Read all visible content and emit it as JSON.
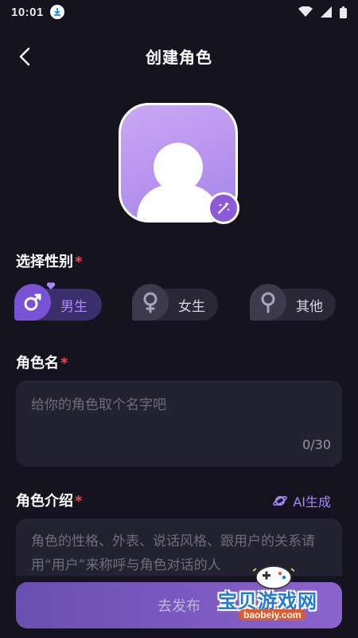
{
  "status_bar": {
    "time": "10:01"
  },
  "header": {
    "title": "创建角色"
  },
  "gender": {
    "label": "选择性别",
    "required": "*",
    "options": [
      {
        "label": "男生",
        "selected": true
      },
      {
        "label": "女生",
        "selected": false
      },
      {
        "label": "其他",
        "selected": false
      }
    ]
  },
  "name_field": {
    "label": "角色名",
    "required": "*",
    "placeholder": "给你的角色取个名字吧",
    "counter": "0/30"
  },
  "intro_field": {
    "label": "角色介绍",
    "required": "*",
    "ai_label": "AI生成",
    "placeholder": "角色的性格、外表、说话风格、跟用户的关系请用“用户”来称呼与角色对话的人"
  },
  "publish": {
    "label": "去发布"
  },
  "watermark": {
    "title": "宝贝游戏网",
    "subtitle": "baobeiy.com"
  },
  "colors": {
    "accent": "#8c59d8",
    "required": "#f0455c",
    "background": "#14131f"
  }
}
